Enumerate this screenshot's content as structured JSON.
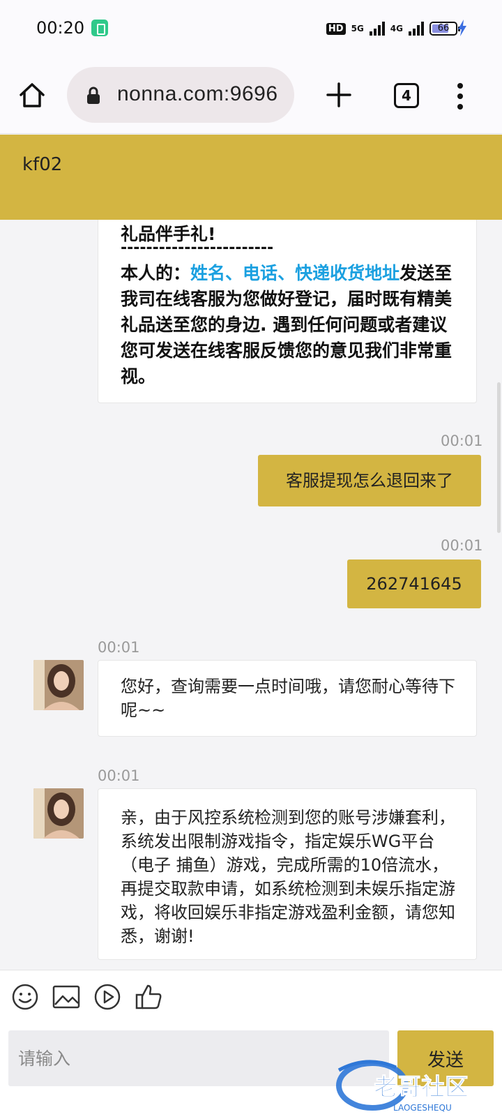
{
  "status_bar": {
    "time": "00:20",
    "hd_label": "HD",
    "net_5g": "5G",
    "net_4g": "4G",
    "battery_level": "66"
  },
  "browser": {
    "url": "nonna.com:9696",
    "tab_count": "4"
  },
  "chat": {
    "title": "kf02",
    "notice": {
      "cut_line": "礼品伴手礼!",
      "separator": "------------------------",
      "prefix": "本人的：",
      "field_name": "姓名",
      "sep1": "、",
      "field_phone": "电话",
      "sep2": "、",
      "field_address": "快递收货地址",
      "rest": "发送至我司在线客服为您做好登记，届时既有精美礼品送至您的身边. 遇到任何问题或者建议您可发送在线客服反馈您的意见我们非常重视。"
    },
    "messages": [
      {
        "sender": "me",
        "time": "00:01",
        "text": "客服提现怎么退回来了"
      },
      {
        "sender": "me",
        "time": "00:01",
        "text": "262741645"
      },
      {
        "sender": "agent",
        "time": "00:01",
        "text": "您好，查询需要一点时间哦，请您耐心等待下呢~~"
      },
      {
        "sender": "agent",
        "time": "00:01",
        "text": "亲，由于风控系统检测到您的账号涉嫌套利，系统发出限制游戏指令，指定娱乐WG平台（电子 捕鱼）游戏，完成所需的10倍流水，再提交取款申请，如系统检测到未娱乐指定游戏，将收回娱乐非指定游戏盈利金额，请您知悉，谢谢!"
      }
    ]
  },
  "composer": {
    "placeholder": "请输入",
    "send_label": "发送",
    "tools": [
      "emoji-icon",
      "image-icon",
      "video-icon",
      "thumbs-up-icon"
    ]
  },
  "watermark": {
    "text": "老哥社区",
    "subtext": "LAOGESHEQU"
  },
  "colors": {
    "accent": "#d3b542",
    "link": "#1ba0e0",
    "background": "#f4f4f6"
  }
}
